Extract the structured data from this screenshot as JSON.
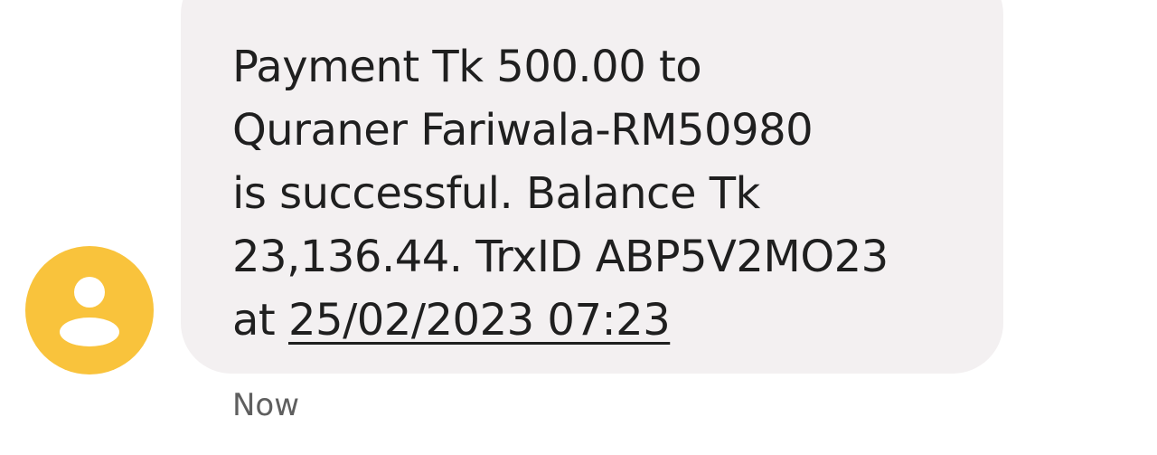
{
  "message": {
    "lines": [
      "Payment Tk 500.00 to",
      "Quraner Fariwala-RM50980",
      "is successful. Balance Tk",
      "23,136.44. TrxID ABP5V2MO23"
    ],
    "last_line_prefix": "at ",
    "date_link": "25/02/2023 07:23",
    "timestamp": "Now"
  },
  "avatar": {
    "icon": "person-icon",
    "color": "#f9c33c"
  },
  "colors": {
    "bubble": "#f3f0f1",
    "text": "#1f1f1f",
    "timestamp": "#5f5f5f"
  }
}
